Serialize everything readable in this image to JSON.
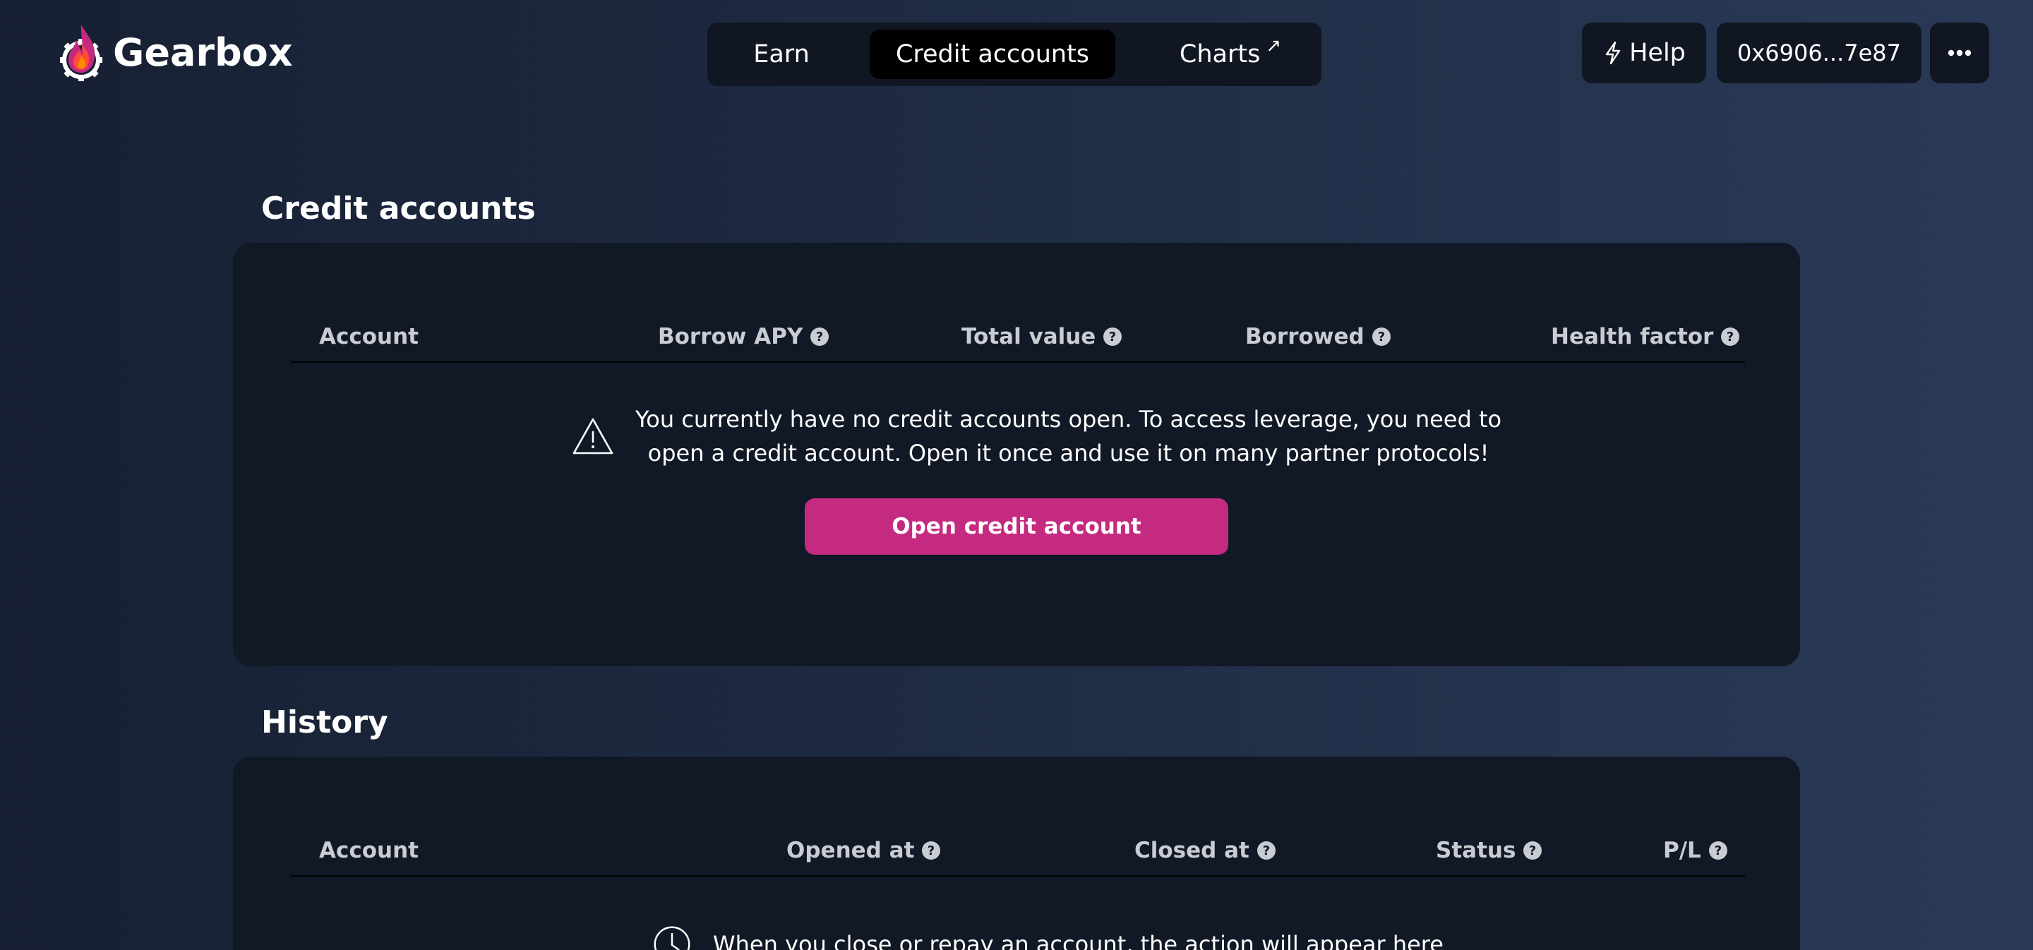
{
  "brand": {
    "name": "Gearbox",
    "flame_colors": [
      "#ff4a3d",
      "#ff8a00",
      "#c42a80"
    ]
  },
  "nav": {
    "items": [
      {
        "label": "Earn",
        "active": false
      },
      {
        "label": "Credit accounts",
        "active": true
      },
      {
        "label": "Charts",
        "active": false,
        "external_icon": "arrow-up-right-icon"
      }
    ],
    "charts_arrow": "↗"
  },
  "header_actions": {
    "help_label": "Help",
    "help_icon": "lightning-icon",
    "wallet_address": "0x6906...7e87",
    "more_icon": "ellipsis-icon"
  },
  "credit_accounts": {
    "title": "Credit accounts",
    "columns": [
      "Account",
      "Borrow APY",
      "Total value",
      "Borrowed",
      "Health factor"
    ],
    "empty_icon": "warning-icon",
    "empty_message_line1": "You currently have no credit accounts open. To access leverage, you need to",
    "empty_message_line2": "open a credit account. Open it once and use it on many partner protocols!",
    "open_button_label": "Open credit account"
  },
  "history": {
    "title": "History",
    "columns": [
      "Account",
      "Opened at",
      "Closed at",
      "Status",
      "P/L"
    ],
    "empty_icon": "clock-icon",
    "empty_message": "When you close or repay an account, the action will appear here"
  },
  "colors": {
    "accent": "#c42a80",
    "card_bg": "#121926",
    "control_bg": "#101622",
    "active_tab_bg": "#000000",
    "header_text": "#c9ccd3"
  }
}
